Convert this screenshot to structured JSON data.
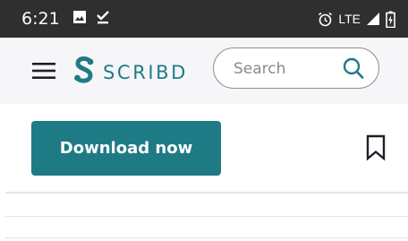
{
  "status_bar": {
    "time": "6:21",
    "network": "LTE"
  },
  "header": {
    "logo_text": "SCRIBD",
    "search": {
      "placeholder": "Search",
      "value": ""
    }
  },
  "actions": {
    "download_label": "Download now"
  },
  "colors": {
    "brand": "#1e7b85",
    "status_bar": "#2f2f2f",
    "header_bg": "#f6f6f9"
  },
  "icons": [
    "image-icon",
    "download-done-icon",
    "alarm-icon",
    "signal-icon",
    "battery-icon",
    "menu-icon",
    "scribd-logo-icon",
    "search-icon",
    "bookmark-icon"
  ]
}
